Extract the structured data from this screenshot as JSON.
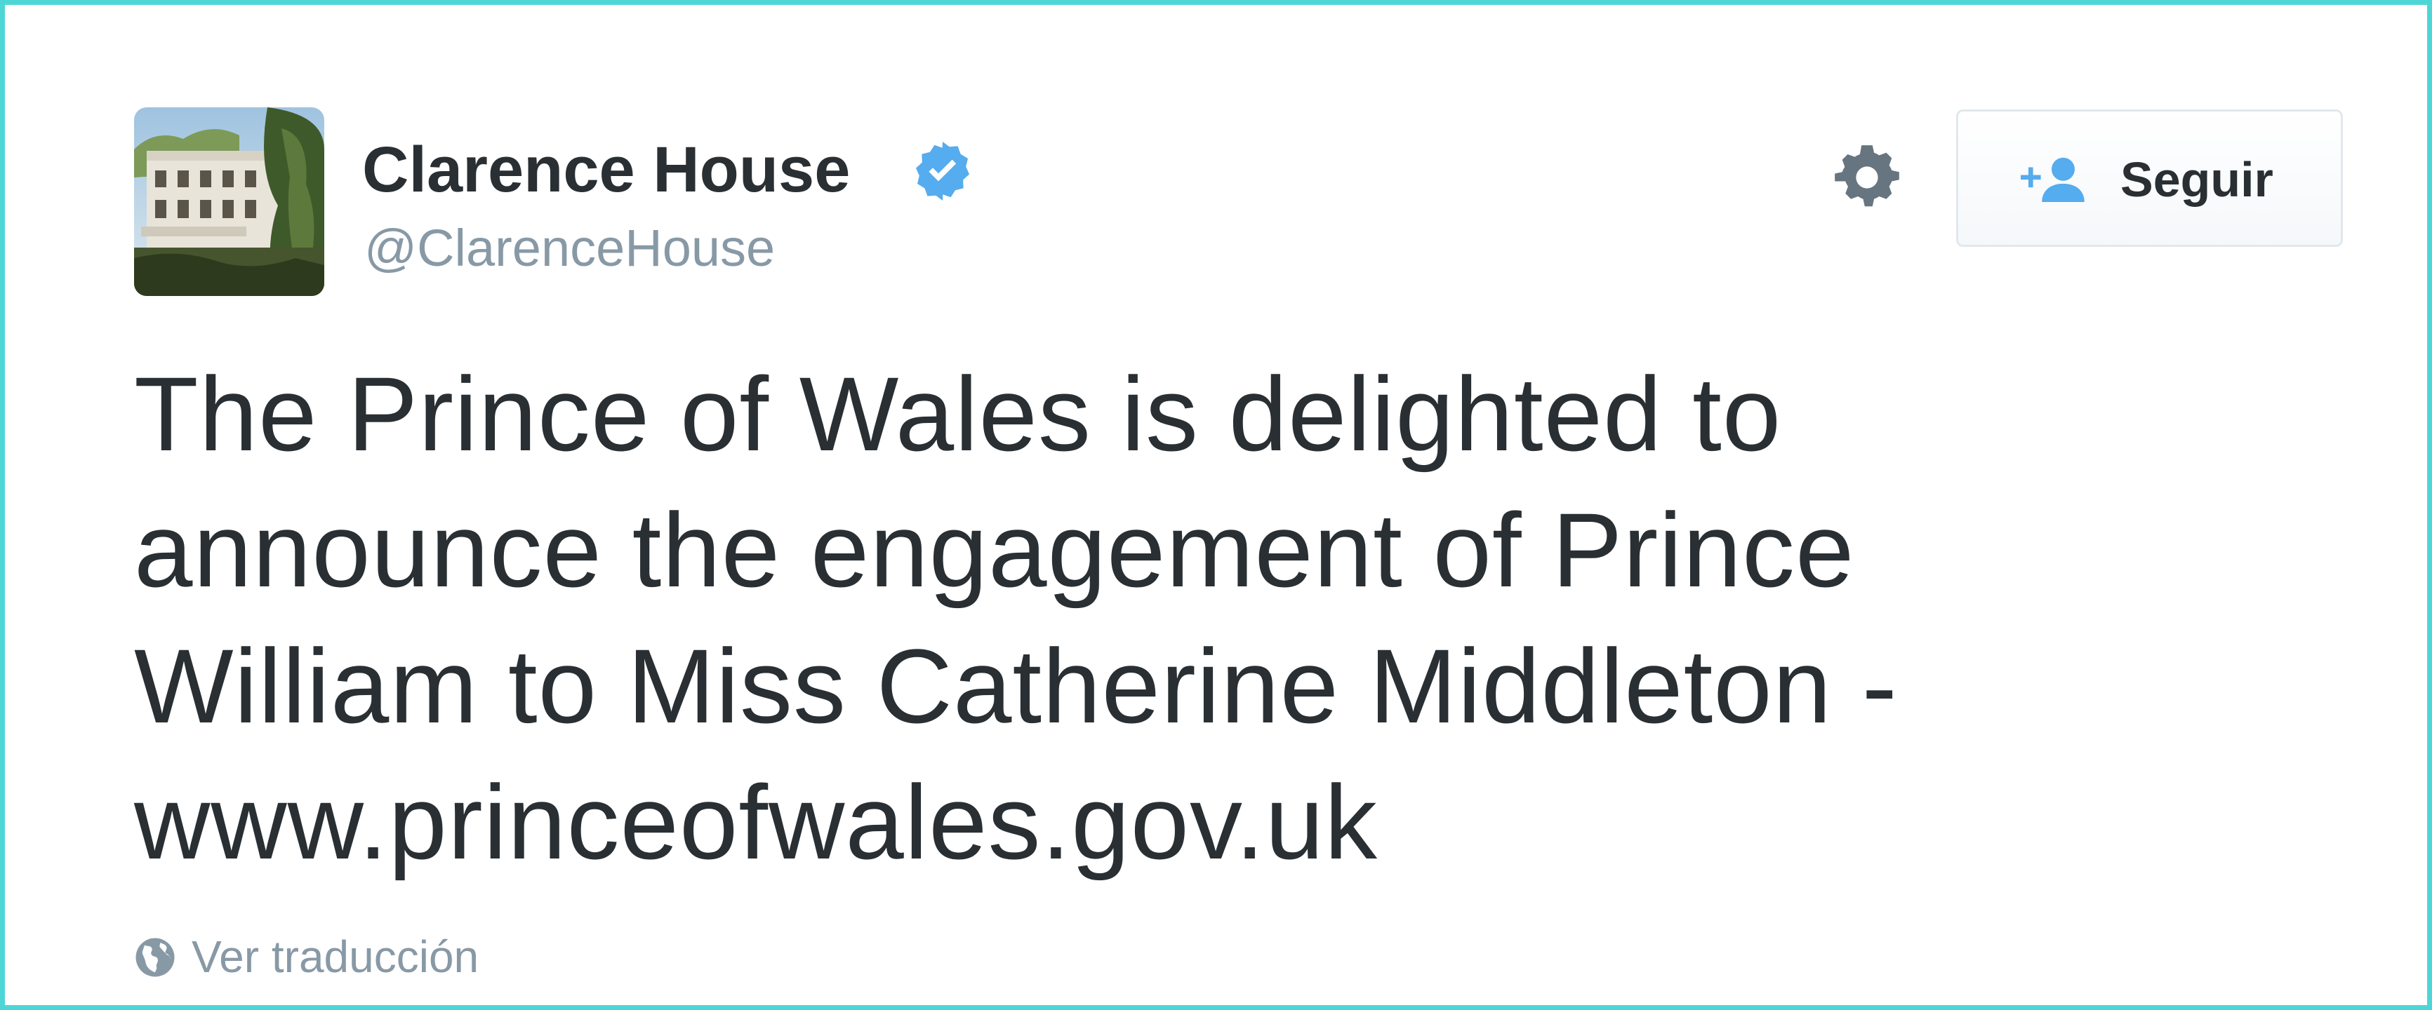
{
  "tweet": {
    "author": {
      "display_name": "Clarence House",
      "handle": "@ClarenceHouse",
      "verified": true,
      "avatar_icon": "building-photo-avatar"
    },
    "actions": {
      "settings_icon": "gear-icon",
      "follow_label": "Seguir",
      "follow_icon": "add-user-icon"
    },
    "text_lines": [
      "The Prince of Wales is delighted to",
      "announce the engagement of Prince",
      "William to Miss Catherine Middleton -",
      "www.princeofwales.gov.uk"
    ],
    "translate_label": "Ver traducción",
    "translate_icon": "globe-icon"
  },
  "colors": {
    "frame_border": "#4ed6d6",
    "text_primary": "#292f33",
    "text_secondary": "#8899a6",
    "verified_badge": "#55acee",
    "follow_icon": "#55acee"
  }
}
